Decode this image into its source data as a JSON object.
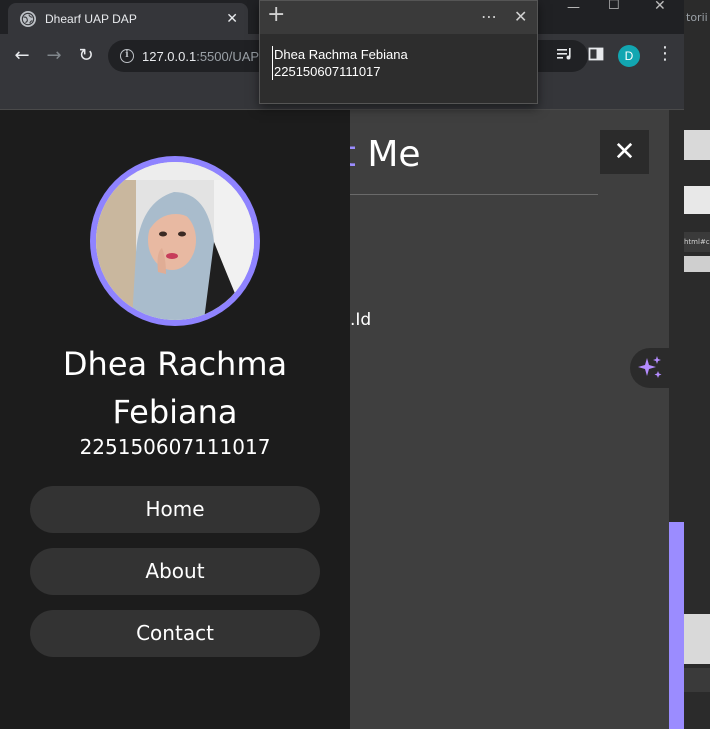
{
  "browser": {
    "tab_title": "Dhearf UAP DAP",
    "tab_close": "✕",
    "url_host": "127.0.0.1",
    "url_rest": ":5500/UAP",
    "avatar_letter": "D",
    "bg_window_tab_text": "torii",
    "bg_window_url_text": "html#cont"
  },
  "popup": {
    "add_symbol": "+",
    "more_symbol": "⋯",
    "close_symbol": "✕",
    "line1": "Dhea Rachma Febiana",
    "line2": "225150607111017"
  },
  "sidebar": {
    "name": "Dhea Rachma Febiana",
    "nim": "225150607111017",
    "nav": [
      {
        "label": "Home"
      },
      {
        "label": "About"
      },
      {
        "label": "Contact"
      }
    ]
  },
  "main": {
    "heading_accent": "ct",
    "heading_rest": " Me",
    "contact_line_partial": ".Id",
    "close_symbol": "✕"
  },
  "colors": {
    "accent": "#9b8cff",
    "sidebar_bg": "#1c1c1c",
    "page_bg": "#3f3f3f",
    "avatar_bg": "#12a6b1"
  }
}
